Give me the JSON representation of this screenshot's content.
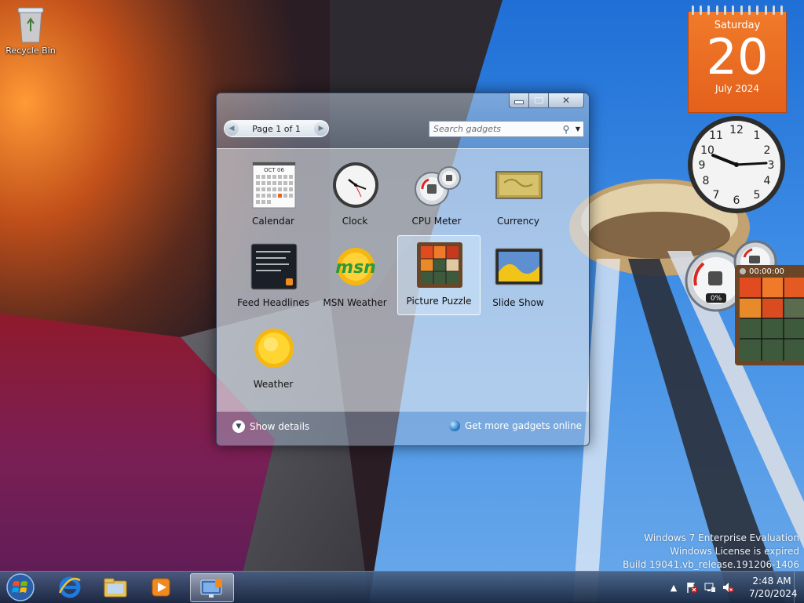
{
  "desktop": {
    "recycle_bin_label": "Recycle Bin"
  },
  "gadget_window": {
    "pager_label": "Page 1 of 1",
    "search_placeholder": "Search gadgets",
    "gadgets": [
      {
        "name": "Calendar",
        "icon": "calendar-icon"
      },
      {
        "name": "Clock",
        "icon": "clock-icon"
      },
      {
        "name": "CPU Meter",
        "icon": "cpu-meter-icon"
      },
      {
        "name": "Currency",
        "icon": "currency-icon"
      },
      {
        "name": "Feed Headlines",
        "icon": "feed-headlines-icon"
      },
      {
        "name": "MSN Weather",
        "icon": "msn-weather-icon"
      },
      {
        "name": "Picture Puzzle",
        "icon": "picture-puzzle-icon"
      },
      {
        "name": "Slide Show",
        "icon": "slide-show-icon"
      },
      {
        "name": "Weather",
        "icon": "weather-icon"
      }
    ],
    "msn_logo_text": "msn",
    "calendar_icon_month": "OCT 06",
    "show_details_label": "Show details",
    "get_more_label": "Get more gadgets online",
    "selected_gadget": "Picture Puzzle"
  },
  "desktop_gadgets": {
    "calendar": {
      "day": "Saturday",
      "date": "20",
      "month": "July 2024"
    },
    "cpu_meter": {
      "cpu_percent": "0%"
    },
    "puzzle": {
      "timer": "00:00:00"
    }
  },
  "watermark": {
    "line1": "Windows 7 Enterprise Evaluation",
    "line2": "Windows License is expired",
    "line3": "Build 19041.vb_release.191206-1406"
  },
  "taskbar": {
    "time": "2:48 AM",
    "date": "7/20/2024"
  },
  "colors": {
    "calendar_orange": "#e9691f",
    "taskbar": "#2a3f5f"
  }
}
